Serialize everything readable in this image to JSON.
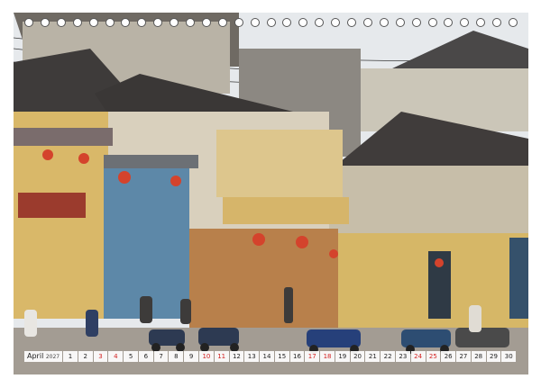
{
  "image": {
    "description_name": "hoi-an-old-town-street",
    "colors": {
      "sky": "#e9ecef",
      "wall_yellow": "#d8b466",
      "wall_blue": "#5b89a8",
      "roof_dark": "#3e3b3a",
      "lantern_red": "#d4432c"
    }
  },
  "calendar": {
    "month": "April",
    "year": "2027",
    "days": [
      {
        "n": "1",
        "c": "black"
      },
      {
        "n": "2",
        "c": "black"
      },
      {
        "n": "3",
        "c": "red"
      },
      {
        "n": "4",
        "c": "red"
      },
      {
        "n": "5",
        "c": "black"
      },
      {
        "n": "6",
        "c": "black"
      },
      {
        "n": "7",
        "c": "black"
      },
      {
        "n": "8",
        "c": "black"
      },
      {
        "n": "9",
        "c": "black"
      },
      {
        "n": "10",
        "c": "red"
      },
      {
        "n": "11",
        "c": "red"
      },
      {
        "n": "12",
        "c": "black"
      },
      {
        "n": "13",
        "c": "black"
      },
      {
        "n": "14",
        "c": "black"
      },
      {
        "n": "15",
        "c": "black"
      },
      {
        "n": "16",
        "c": "black"
      },
      {
        "n": "17",
        "c": "red"
      },
      {
        "n": "18",
        "c": "red"
      },
      {
        "n": "19",
        "c": "black"
      },
      {
        "n": "20",
        "c": "black"
      },
      {
        "n": "21",
        "c": "black"
      },
      {
        "n": "22",
        "c": "black"
      },
      {
        "n": "23",
        "c": "black"
      },
      {
        "n": "24",
        "c": "red"
      },
      {
        "n": "25",
        "c": "red"
      },
      {
        "n": "26",
        "c": "black"
      },
      {
        "n": "27",
        "c": "black"
      },
      {
        "n": "28",
        "c": "black"
      },
      {
        "n": "29",
        "c": "black"
      },
      {
        "n": "30",
        "c": "black"
      }
    ]
  },
  "binding": {
    "ring_count": 31
  }
}
